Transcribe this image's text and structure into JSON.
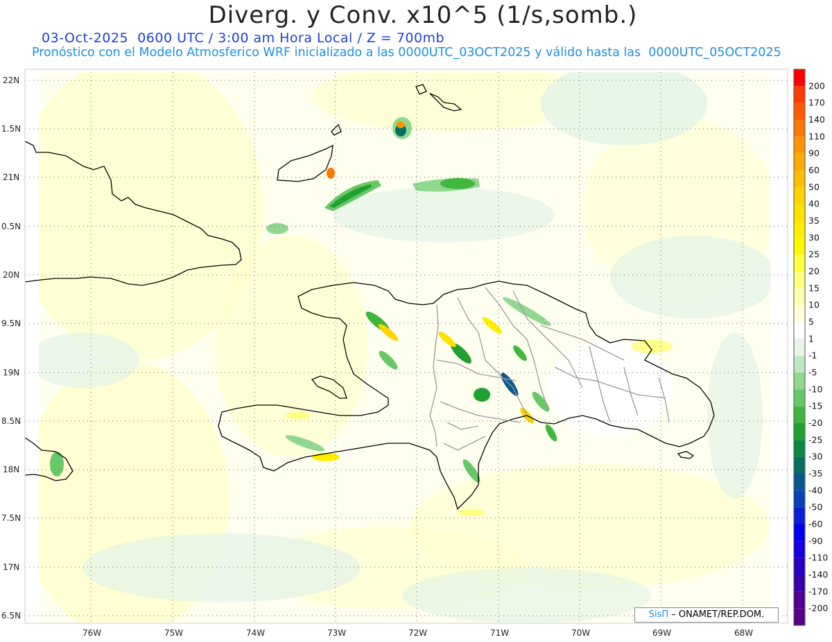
{
  "title": "Diverg. y Conv. x10^5 (1/s,somb.)",
  "subtitle_line1": "03-Oct-2025  0600 UTC / 3:00 am Hora Local / Z = 700mb",
  "subtitle_line2": "Pronóstico con el Modelo Atmosferico WRF inicializado a las 0000UTC_03OCT2025 y válido hasta las  0000UTC_05OCT2025",
  "credit": {
    "brand": "SisΠ",
    "text": " – ONAMET/REP.DOM."
  },
  "map": {
    "lat_labels": [
      "22N",
      "1.5N",
      "21N",
      "0.5N",
      "20N",
      "9.5N",
      "19N",
      "8.5N",
      "18N",
      "7.5N",
      "17N",
      "6.5N"
    ],
    "lon_labels": [
      "76W",
      "75W",
      "74W",
      "73W",
      "72W",
      "71W",
      "70W",
      "69W",
      "68W"
    ],
    "features": [
      "Cuba (east)",
      "Great Inagua",
      "Jamaica (east)",
      "Hispaniola",
      "Gonâve Island",
      "Turks and Caicos"
    ]
  },
  "colorbar": {
    "levels": [
      {
        "label": "200",
        "color": "#ff1a00"
      },
      {
        "label": "170",
        "color": "#ff3c00"
      },
      {
        "label": "140",
        "color": "#ff5a00"
      },
      {
        "label": "110",
        "color": "#ff7800"
      },
      {
        "label": "90",
        "color": "#ff9600"
      },
      {
        "label": "60",
        "color": "#ffaa00"
      },
      {
        "label": "50",
        "color": "#ffbe00"
      },
      {
        "label": "40",
        "color": "#ffd200"
      },
      {
        "label": "35",
        "color": "#ffe100"
      },
      {
        "label": "30",
        "color": "#ffee00"
      },
      {
        "label": "25",
        "color": "#fff700"
      },
      {
        "label": "20",
        "color": "#ffff40"
      },
      {
        "label": "15",
        "color": "#ffff80"
      },
      {
        "label": "10",
        "color": "#ffffb0"
      },
      {
        "label": "5",
        "color": "#ffffd8"
      },
      {
        "label": "1",
        "color": "#ffffff"
      },
      {
        "label": "-1",
        "color": "#e6f5e6"
      },
      {
        "label": "-5",
        "color": "#c0e8c0"
      },
      {
        "label": "-10",
        "color": "#90d890"
      },
      {
        "label": "-15",
        "color": "#66c866"
      },
      {
        "label": "-20",
        "color": "#40b840"
      },
      {
        "label": "-25",
        "color": "#20a030"
      },
      {
        "label": "-30",
        "color": "#0a8a40"
      },
      {
        "label": "-35",
        "color": "#067060"
      },
      {
        "label": "-40",
        "color": "#0a5890"
      },
      {
        "label": "-50",
        "color": "#0a40b8"
      },
      {
        "label": "-60",
        "color": "#0a20d8"
      },
      {
        "label": "-90",
        "color": "#0000f0"
      },
      {
        "label": "-110",
        "color": "#1400e0"
      },
      {
        "label": "-140",
        "color": "#2800c0"
      },
      {
        "label": "-170",
        "color": "#3c00a8"
      },
      {
        "label": "-200",
        "color": "#500090"
      }
    ],
    "top_color": "#ff0000",
    "bottom_color": "#5a0088"
  }
}
